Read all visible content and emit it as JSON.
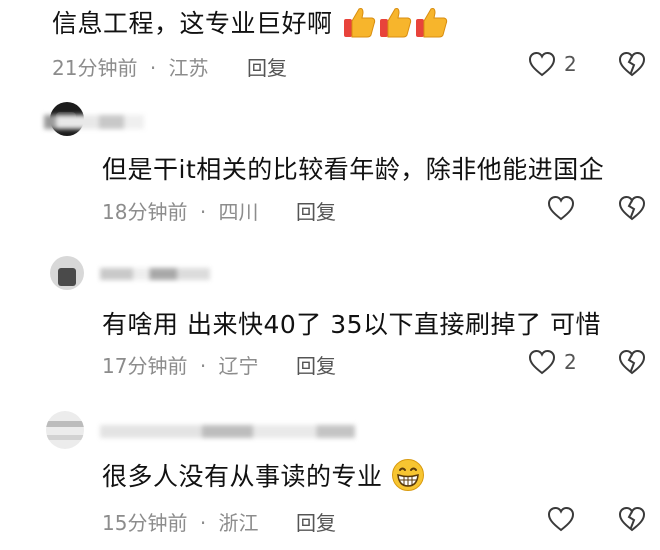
{
  "comments": [
    {
      "text": "信息工程，这专业巨好啊",
      "time": "21分钟前",
      "separator": "·",
      "location": "江苏",
      "reply_label": "回复",
      "like_count": "2",
      "emojis": [
        "thumbs-up",
        "thumbs-up",
        "thumbs-up"
      ]
    },
    {
      "text": "但是干it相关的比较看年龄，除非他能进国企",
      "time": "18分钟前",
      "separator": "·",
      "location": "四川",
      "reply_label": "回复"
    },
    {
      "text": "有啥用 出来快40了 35以下直接刷掉了 可惜",
      "time": "17分钟前",
      "separator": "·",
      "location": "辽宁",
      "reply_label": "回复",
      "like_count": "2"
    },
    {
      "text": "很多人没有从事读的专业",
      "time": "15分钟前",
      "separator": "·",
      "location": "浙江",
      "reply_label": "回复",
      "emojis": [
        "grinning-face"
      ]
    }
  ],
  "colors": {
    "meta_text": "#8c8c8c",
    "icon_stroke": "#3a3a3a",
    "emoji_yellow": "#f7b52c",
    "emoji_red": "#e8433b"
  }
}
